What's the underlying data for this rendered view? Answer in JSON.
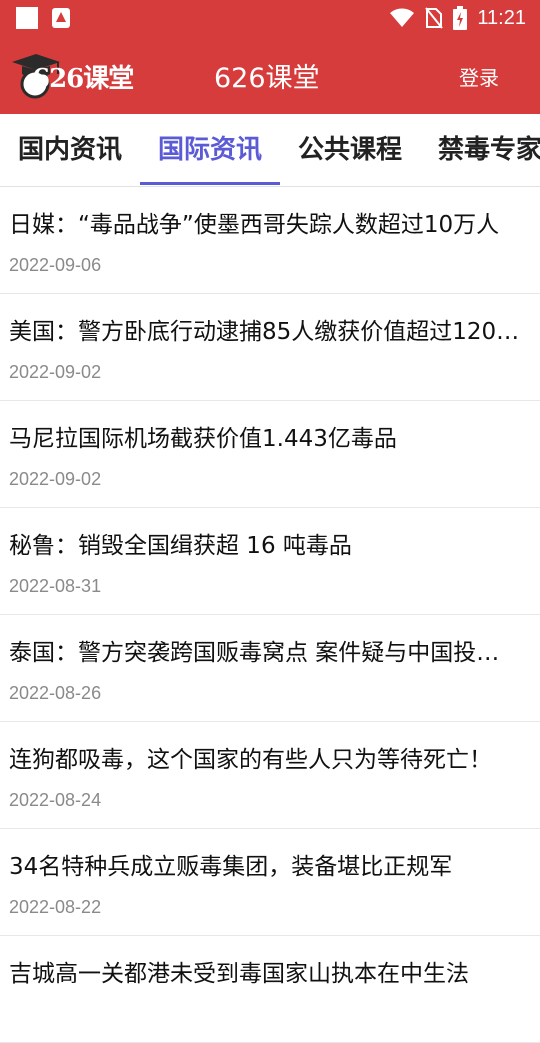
{
  "status_bar": {
    "time": "11:21",
    "icons": [
      "notification-square-icon",
      "app-a-icon",
      "wifi-icon",
      "no-sim-icon",
      "battery-charging-icon"
    ]
  },
  "app_bar": {
    "logo_text": "626课堂",
    "title": "626课堂",
    "login_label": "登录"
  },
  "tabs": [
    {
      "label": "国内资讯",
      "active": false
    },
    {
      "label": "国际资讯",
      "active": true
    },
    {
      "label": "公共课程",
      "active": false
    },
    {
      "label": "禁毒专家",
      "active": false
    }
  ],
  "news": [
    {
      "title": "日媒：“毒品战争”使墨西哥失踪人数超过10万人",
      "date": "2022-09-06"
    },
    {
      "title": "美国：警方卧底行动逮捕85人缴获价值超过120…",
      "date": "2022-09-02"
    },
    {
      "title": "马尼拉国际机场截获价值1.443亿毒品",
      "date": "2022-09-02"
    },
    {
      "title": "秘鲁：销毁全国缉获超 16 吨毒品",
      "date": "2022-08-31"
    },
    {
      "title": "泰国：警方突袭跨国贩毒窝点 案件疑与中国投…",
      "date": "2022-08-26"
    },
    {
      "title": "连狗都吸毒，这个国家的有些人只为等待死亡！",
      "date": "2022-08-24"
    },
    {
      "title": "34名特种兵成立贩毒集团，装备堪比正规军",
      "date": "2022-08-22"
    },
    {
      "title": "吉城高一关都港未受到毒国家山执本在中生法",
      "date": ""
    }
  ],
  "colors": {
    "app_bar": "#d63c3c",
    "active_tab": "#5b5bd6"
  }
}
